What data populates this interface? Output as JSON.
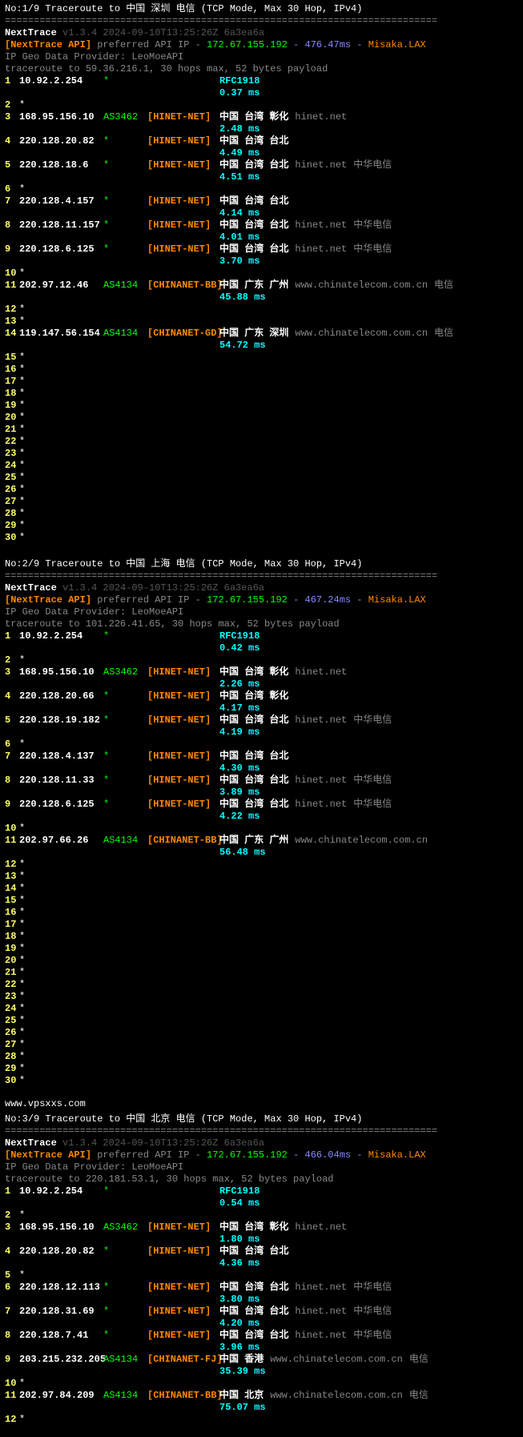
{
  "blocks": [
    {
      "title": "No:1/9 Traceroute to 中国 深圳 电信 (TCP Mode, Max 30 Hop, IPv4)",
      "sep": "===========================================================================",
      "nt": "NextTrace",
      "ver": "v1.3.4 2024-09-10T13:25:26Z 6a3ea6a",
      "api_label": "[NextTrace API]",
      "api_text": " preferred API IP - ",
      "api_ip": "172.67.155.192",
      "api_rtt": " - 476.47ms - ",
      "api_srv": "Misaka.LAX",
      "geo": "IP Geo Data Provider: LeoMoeAPI",
      "tr": "traceroute to 59.36.216.1, 30 hops max, 52 bytes payload",
      "hops": [
        {
          "n": "1",
          "ip": "10.92.2.254",
          "asn": "*",
          "net": "",
          "geo": "",
          "rfc": "RFC1918",
          "time": "0.37 ms"
        },
        {
          "n": "2",
          "star": true
        },
        {
          "n": "3",
          "ip": "168.95.156.10",
          "asn": "AS3462",
          "net": "[HINET-NET]",
          "geo": "中国 台湾 彰化",
          "dns": "hinet.net",
          "time": "2.48 ms"
        },
        {
          "n": "4",
          "ip": "220.128.20.82",
          "asn": "*",
          "net": "[HINET-NET]",
          "geo": "中国 台湾 台北",
          "time": "4.49 ms"
        },
        {
          "n": "5",
          "ip": "220.128.18.6",
          "asn": "*",
          "net": "[HINET-NET]",
          "geo": "中国 台湾 台北",
          "dns": "hinet.net",
          "isp": "中华电信",
          "time": "4.51 ms"
        },
        {
          "n": "6",
          "star": true
        },
        {
          "n": "7",
          "ip": "220.128.4.157",
          "asn": "*",
          "net": "[HINET-NET]",
          "geo": "中国 台湾 台北",
          "time": "4.14 ms"
        },
        {
          "n": "8",
          "ip": "220.128.11.157",
          "asn": "*",
          "net": "[HINET-NET]",
          "geo": "中国 台湾 台北",
          "dns": "hinet.net",
          "isp": "中华电信",
          "time": "4.01 ms"
        },
        {
          "n": "9",
          "ip": "220.128.6.125",
          "asn": "*",
          "net": "[HINET-NET]",
          "geo": "中国 台湾 台北",
          "dns": "hinet.net",
          "isp": "中华电信",
          "time": "3.70 ms"
        },
        {
          "n": "10",
          "star": true
        },
        {
          "n": "11",
          "ip": "202.97.12.46",
          "asn": "AS4134",
          "net": "[CHINANET-BB]",
          "geo": "中国 广东 广州",
          "dns": "www.chinatelecom.com.cn",
          "isp": "电信",
          "time": "45.88 ms"
        },
        {
          "n": "12",
          "star": true
        },
        {
          "n": "13",
          "star": true
        },
        {
          "n": "14",
          "ip": "119.147.56.154",
          "asn": "AS4134",
          "net": "[CHINANET-GD]",
          "geo": "中国 广东 深圳",
          "dns": "www.chinatelecom.com.cn",
          "isp": "电信",
          "time": "54.72 ms"
        },
        {
          "n": "15",
          "star": true
        },
        {
          "n": "16",
          "star": true
        },
        {
          "n": "17",
          "star": true
        },
        {
          "n": "18",
          "star": true
        },
        {
          "n": "19",
          "star": true
        },
        {
          "n": "20",
          "star": true
        },
        {
          "n": "21",
          "star": true
        },
        {
          "n": "22",
          "star": true
        },
        {
          "n": "23",
          "star": true
        },
        {
          "n": "24",
          "star": true
        },
        {
          "n": "25",
          "star": true
        },
        {
          "n": "26",
          "star": true
        },
        {
          "n": "27",
          "star": true
        },
        {
          "n": "28",
          "star": true
        },
        {
          "n": "29",
          "star": true
        },
        {
          "n": "30",
          "star": true
        }
      ]
    },
    {
      "title": "No:2/9 Traceroute to 中国 上海 电信 (TCP Mode, Max 30 Hop, IPv4)",
      "sep": "===========================================================================",
      "nt": "NextTrace",
      "ver": "v1.3.4 2024-09-10T13:25:26Z 6a3ea6a",
      "api_label": "[NextTrace API]",
      "api_text": " preferred API IP - ",
      "api_ip": "172.67.155.192",
      "api_rtt": " - 467.24ms - ",
      "api_srv": "Misaka.LAX",
      "geo": "IP Geo Data Provider: LeoMoeAPI",
      "tr": "traceroute to 101.226.41.65, 30 hops max, 52 bytes payload",
      "hops": [
        {
          "n": "1",
          "ip": "10.92.2.254",
          "asn": "*",
          "net": "",
          "geo": "",
          "rfc": "RFC1918",
          "time": "0.42 ms"
        },
        {
          "n": "2",
          "star": true
        },
        {
          "n": "3",
          "ip": "168.95.156.10",
          "asn": "AS3462",
          "net": "[HINET-NET]",
          "geo": "中国 台湾 彰化",
          "dns": "hinet.net",
          "time": "2.26 ms"
        },
        {
          "n": "4",
          "ip": "220.128.20.66",
          "asn": "*",
          "net": "[HINET-NET]",
          "geo": "中国 台湾 彰化",
          "time": "4.17 ms"
        },
        {
          "n": "5",
          "ip": "220.128.19.182",
          "asn": "*",
          "net": "[HINET-NET]",
          "geo": "中国 台湾 台北",
          "dns": "hinet.net",
          "isp": "中华电信",
          "time": "4.19 ms"
        },
        {
          "n": "6",
          "star": true
        },
        {
          "n": "7",
          "ip": "220.128.4.137",
          "asn": "*",
          "net": "[HINET-NET]",
          "geo": "中国 台湾 台北",
          "time": "4.30 ms"
        },
        {
          "n": "8",
          "ip": "220.128.11.33",
          "asn": "*",
          "net": "[HINET-NET]",
          "geo": "中国 台湾 台北",
          "dns": "hinet.net",
          "isp": "中华电信",
          "time": "3.89 ms"
        },
        {
          "n": "9",
          "ip": "220.128.6.125",
          "asn": "*",
          "net": "[HINET-NET]",
          "geo": "中国 台湾 台北",
          "dns": "hinet.net",
          "isp": "中华电信",
          "time": "4.22 ms"
        },
        {
          "n": "10",
          "star": true
        },
        {
          "n": "11",
          "ip": "202.97.66.26",
          "asn": "AS4134",
          "net": "[CHINANET-BB]",
          "geo": "中国 广东 广州",
          "dns": "www.chinatelecom.com.cn",
          "time": "56.48 ms"
        },
        {
          "n": "12",
          "star": true
        },
        {
          "n": "13",
          "star": true
        },
        {
          "n": "14",
          "star": true
        },
        {
          "n": "15",
          "star": true
        },
        {
          "n": "16",
          "star": true
        },
        {
          "n": "17",
          "star": true
        },
        {
          "n": "18",
          "star": true
        },
        {
          "n": "19",
          "star": true
        },
        {
          "n": "20",
          "star": true
        },
        {
          "n": "21",
          "star": true
        },
        {
          "n": "22",
          "star": true
        },
        {
          "n": "23",
          "star": true
        },
        {
          "n": "24",
          "star": true
        },
        {
          "n": "25",
          "star": true
        },
        {
          "n": "26",
          "star": true
        },
        {
          "n": "27",
          "star": true
        },
        {
          "n": "28",
          "star": true
        },
        {
          "n": "29",
          "star": true
        },
        {
          "n": "30",
          "star": true
        }
      ]
    },
    {
      "watermark": "www.vpsxxs.com",
      "title": "No:3/9 Traceroute to 中国 北京 电信 (TCP Mode, Max 30 Hop, IPv4)",
      "sep": "===========================================================================",
      "nt": "NextTrace",
      "ver": "v1.3.4 2024-09-10T13:25:26Z 6a3ea6a",
      "api_label": "[NextTrace API]",
      "api_text": " preferred API IP - ",
      "api_ip": "172.67.155.192",
      "api_rtt": " - 466.04ms - ",
      "api_srv": "Misaka.LAX",
      "geo": "IP Geo Data Provider: LeoMoeAPI",
      "tr": "traceroute to 220.181.53.1, 30 hops max, 52 bytes payload",
      "hops": [
        {
          "n": "1",
          "ip": "10.92.2.254",
          "asn": "*",
          "net": "",
          "geo": "",
          "rfc": "RFC1918",
          "time": "0.54 ms"
        },
        {
          "n": "2",
          "star": true
        },
        {
          "n": "3",
          "ip": "168.95.156.10",
          "asn": "AS3462",
          "net": "[HINET-NET]",
          "geo": "中国 台湾 彰化",
          "dns": "hinet.net",
          "time": "1.80 ms"
        },
        {
          "n": "4",
          "ip": "220.128.20.82",
          "asn": "*",
          "net": "[HINET-NET]",
          "geo": "中国 台湾 台北",
          "time": "4.36 ms"
        },
        {
          "n": "5",
          "star": true
        },
        {
          "n": "6",
          "ip": "220.128.12.113",
          "asn": "*",
          "net": "[HINET-NET]",
          "geo": "中国 台湾 台北",
          "dns": "hinet.net",
          "isp": "中华电信",
          "time": "3.80 ms"
        },
        {
          "n": "7",
          "ip": "220.128.31.69",
          "asn": "*",
          "net": "[HINET-NET]",
          "geo": "中国 台湾 台北",
          "dns": "hinet.net",
          "isp": "中华电信",
          "time": "4.20 ms"
        },
        {
          "n": "8",
          "ip": "220.128.7.41",
          "asn": "*",
          "net": "[HINET-NET]",
          "geo": "中国 台湾 台北",
          "dns": "hinet.net",
          "isp": "中华电信",
          "time": "3.96 ms"
        },
        {
          "n": "9",
          "ip": "203.215.232.205",
          "asn": "AS4134",
          "net": "[CHINANET-FJ]",
          "geo": "中国 香港",
          "dns": "www.chinatelecom.com.cn",
          "isp": "电信",
          "time": "35.39 ms"
        },
        {
          "n": "10",
          "star": true
        },
        {
          "n": "11",
          "ip": "202.97.84.209",
          "asn": "AS4134",
          "net": "[CHINANET-BB]",
          "geo": "中国 北京",
          "dns": "www.chinatelecom.com.cn",
          "isp": "电信",
          "time": "75.07 ms"
        },
        {
          "n": "12",
          "star": true
        }
      ]
    }
  ]
}
